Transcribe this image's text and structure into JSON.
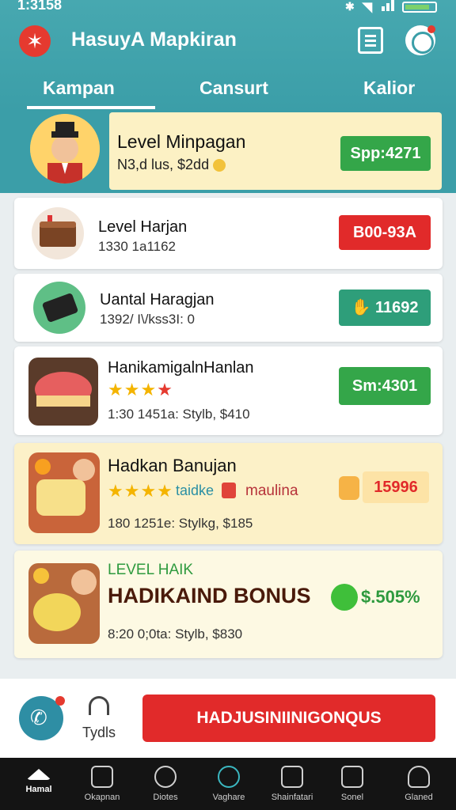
{
  "status": {
    "time": "1:3158"
  },
  "app": {
    "title": "HasuyA Mapkiran"
  },
  "tabs": [
    {
      "label": "Kampan"
    },
    {
      "label": "Cansurt"
    },
    {
      "label": "Kalior"
    }
  ],
  "featured": {
    "title": "Level Minpagan",
    "subtitle": "N3,d lus, $2dd",
    "price": "Spp:4271"
  },
  "rows": [
    {
      "title": "Level Harjan",
      "subtitle": "1330  1a1162",
      "button": "B00-93A"
    },
    {
      "title": "Uantal Haragjan",
      "subtitle": "1392/ I\\/kss3I: 0",
      "button": "11692"
    },
    {
      "title": "HanikamigalnHanlan",
      "subtitle": "1:30  1451a: Stylb, $410",
      "button": "Sm:4301"
    },
    {
      "title": "Hadkan Banujan",
      "stars_extra": "taidke",
      "tag": "maulina",
      "subtitle": "180  1251e: Stylkg, $185",
      "button": "15996"
    },
    {
      "kicker": "LEVEL HAIK",
      "title": "HADIKAIND BONUS",
      "subtitle": "8:20  0;0ta: Stylb, $830",
      "bonus": "$.505%"
    }
  ],
  "actionbar": {
    "label": "Tydls",
    "button": "HADJUSINIINIGONQUS"
  },
  "nav": [
    {
      "label": "Hamal"
    },
    {
      "label": "Okapnan"
    },
    {
      "label": "Diotes"
    },
    {
      "label": "Vaghare"
    },
    {
      "label": "Shainfatari"
    },
    {
      "label": "Sonel"
    },
    {
      "label": "Glaned"
    }
  ]
}
